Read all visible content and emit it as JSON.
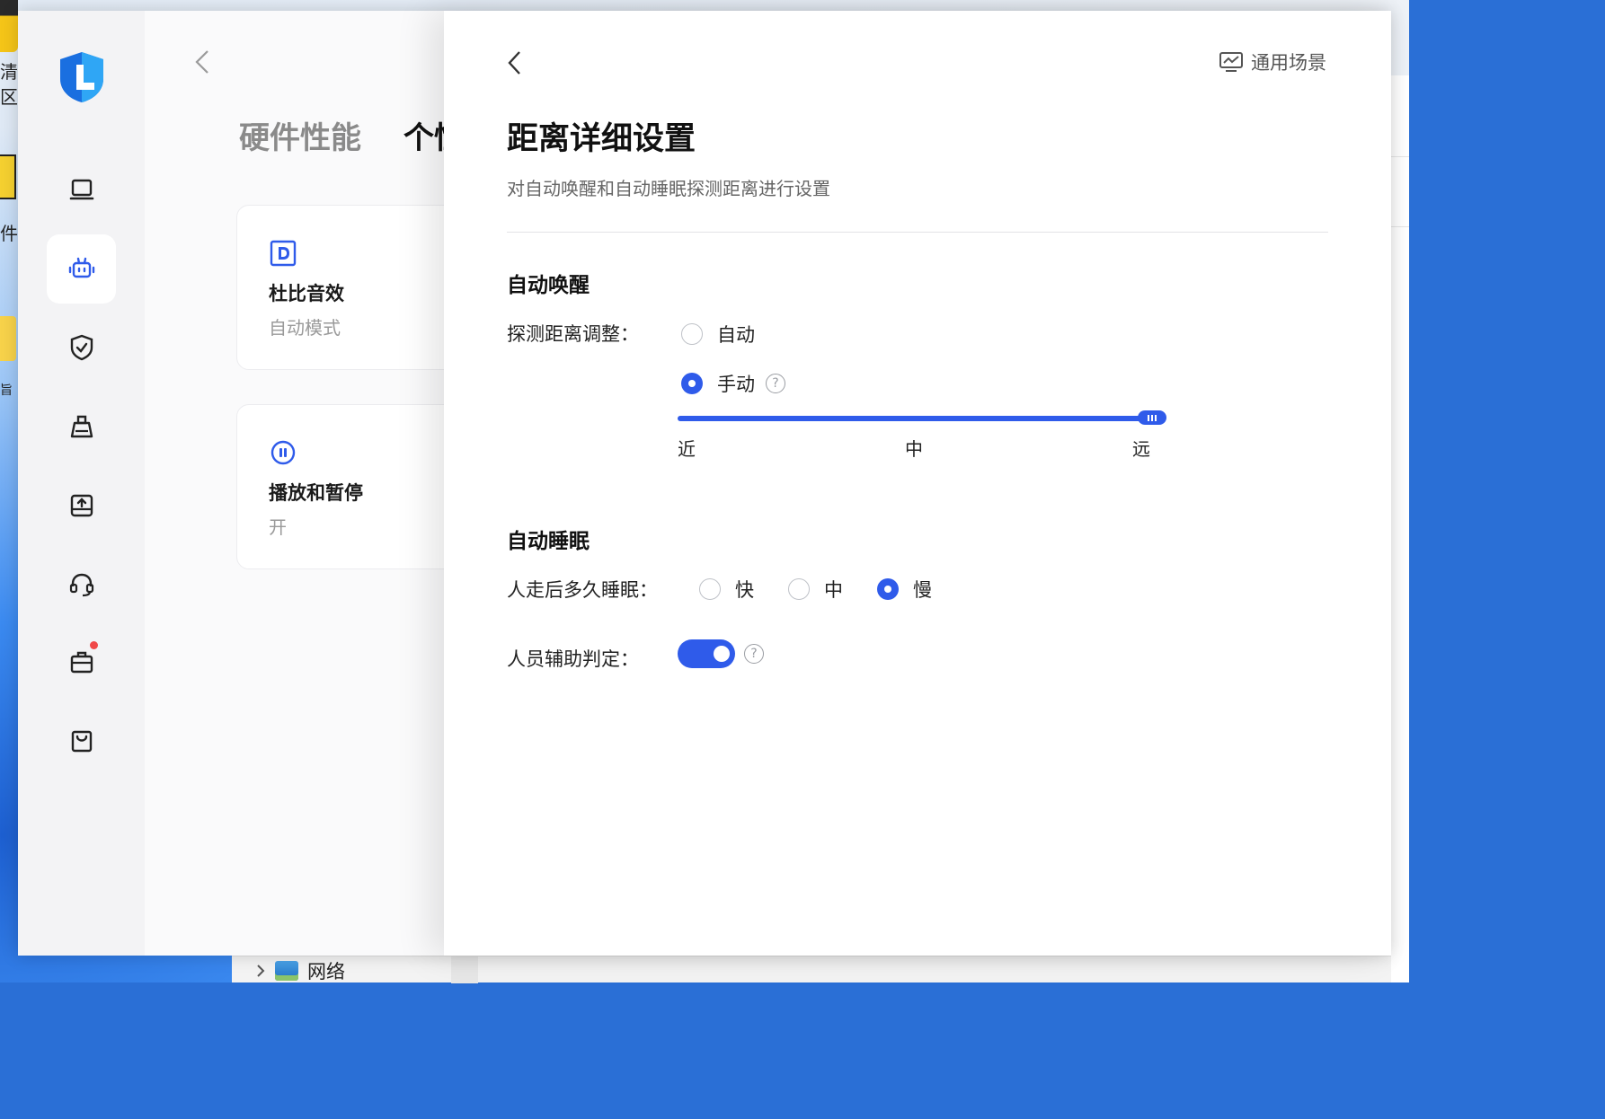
{
  "desktop": {
    "fragments": [
      "清",
      "区",
      "件",
      "旨"
    ],
    "network_label": "网络"
  },
  "sidebar": {
    "logo": "app-logo",
    "items": [
      {
        "name": "device",
        "icon": "laptop-icon",
        "active": false
      },
      {
        "name": "smart",
        "icon": "robot-icon",
        "active": true
      },
      {
        "name": "security",
        "icon": "shield-check-icon",
        "active": false
      },
      {
        "name": "clean",
        "icon": "broom-icon",
        "active": false
      },
      {
        "name": "drivers",
        "icon": "upload-tray-icon",
        "active": false
      },
      {
        "name": "service",
        "icon": "headset-icon",
        "active": false
      },
      {
        "name": "toolbox",
        "icon": "toolbox-icon",
        "active": false,
        "badge": true
      },
      {
        "name": "store",
        "icon": "shopping-bag-icon",
        "active": false
      }
    ]
  },
  "main": {
    "tabs": [
      {
        "label": "硬件性能",
        "active": false
      },
      {
        "label": "个性",
        "active": true
      }
    ],
    "cards": [
      {
        "icon": "dolby-icon",
        "title": "杜比音效",
        "value": "自动模式"
      },
      {
        "icon": "pause-circle-icon",
        "title": "播放和暂停",
        "value": "开"
      }
    ]
  },
  "panel": {
    "scene_label": "通用场景",
    "title": "距离详细设置",
    "subtitle": "对自动唤醒和自动睡眠探测距离进行设置",
    "wake": {
      "section": "自动唤醒",
      "label": "探测距离调整：",
      "options": [
        {
          "label": "自动",
          "selected": false
        },
        {
          "label": "手动",
          "selected": true,
          "help": "?"
        }
      ],
      "slider": {
        "value": 1.0,
        "ticks": [
          "近",
          "中",
          "远"
        ]
      }
    },
    "sleep": {
      "section": "自动睡眠",
      "label": "人走后多久睡眠：",
      "options": [
        {
          "label": "快",
          "selected": false
        },
        {
          "label": "中",
          "selected": false
        },
        {
          "label": "慢",
          "selected": true
        }
      ]
    },
    "assist": {
      "label": "人员辅助判定：",
      "enabled": true,
      "help": "?"
    }
  },
  "colors": {
    "accent": "#2f5bea",
    "sidebar_bg": "#f3f3f5",
    "muted_text": "#9a9a9a"
  }
}
